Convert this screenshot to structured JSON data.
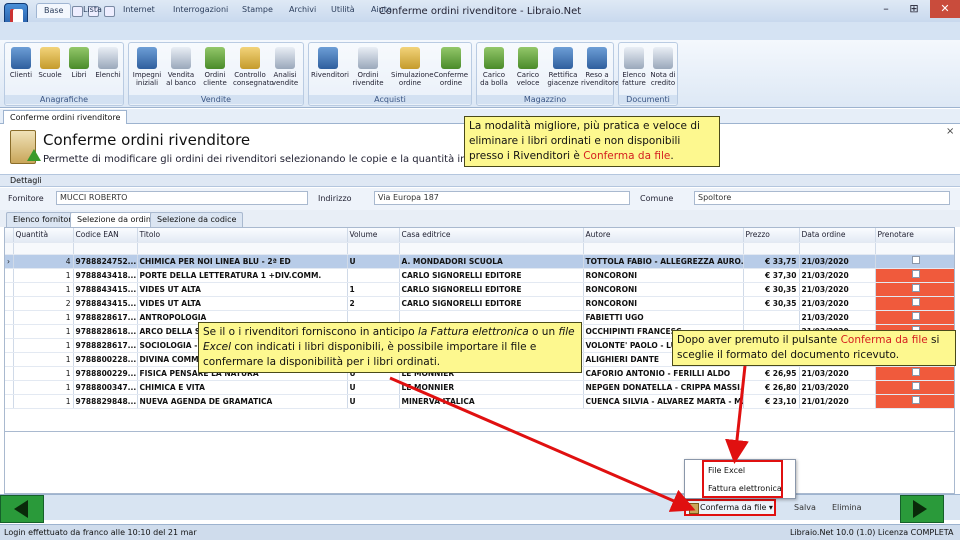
{
  "window": {
    "title": "Conferme ordini rivenditore - Libraio.Net",
    "minimize": "–",
    "restore": "⊞",
    "close": "✕"
  },
  "ribbon_tabs": [
    "Base",
    "Lista",
    "Internet",
    "Interrogazioni",
    "Stampe",
    "Archivi",
    "Utilità",
    "Aiuto"
  ],
  "ribbon_groups": [
    {
      "label": "Anagrafiche",
      "buttons": [
        "Clienti",
        "Scuole",
        "Libri",
        "Elenchi"
      ]
    },
    {
      "label": "Vendite",
      "buttons": [
        "Impegni iniziali",
        "Vendita al banco",
        "Ordini cliente",
        "Controllo consegnato",
        "Analisi vendite"
      ]
    },
    {
      "label": "Acquisti",
      "buttons": [
        "Rivenditori",
        "Ordini rivendite",
        "Simulazione ordine",
        "Conferme ordine"
      ]
    },
    {
      "label": "Magazzino",
      "buttons": [
        "Carico da bolla",
        "Carico veloce",
        "Rettifica giacenze",
        "Reso a rivenditore"
      ]
    },
    {
      "label": "Documenti",
      "buttons": [
        "Elenco fatture",
        "Nota di credito"
      ]
    }
  ],
  "doc_tab": "Conferme ordini rivenditore",
  "header": {
    "title": "Conferme ordini rivenditore",
    "subtitle": "Permette di modificare gli ordini dei rivenditori selezionando le copie e la quantità in arrivo",
    "close": "×"
  },
  "details": {
    "section": "Dettagli",
    "fornitore_label": "Fornitore",
    "fornitore": "MUCCI ROBERTO",
    "indirizzo_label": "Indirizzo",
    "indirizzo": "Via Europa 187",
    "comune_label": "Comune",
    "comune": "Spoltore"
  },
  "sub_tabs": [
    "Elenco fornitori",
    "Selezione da ordine",
    "Selezione da codice"
  ],
  "grid": {
    "columns": [
      "Quantità",
      "Codice EAN",
      "Titolo",
      "Volume",
      "Casa editrice",
      "Autore",
      "Prezzo",
      "Data ordine",
      "Prenotare"
    ],
    "rows": [
      {
        "q": "4",
        "ean": "9788824752...",
        "titolo": "CHIMICA PER NOI LINEA BLU - 2ª ED",
        "vol": "U",
        "casa": "A. MONDADORI SCUOLA",
        "autore": "TOTTOLA FABIO - ALLEGREZZA AURO...",
        "prezzo": "€ 33,75",
        "data": "21/03/2020"
      },
      {
        "q": "1",
        "ean": "9788843418...",
        "titolo": "PORTE DELLA LETTERATURA 1 +DIV.COMM.",
        "vol": "",
        "casa": "CARLO SIGNORELLI EDITORE",
        "autore": "RONCORONI",
        "prezzo": "€ 37,30",
        "data": "21/03/2020"
      },
      {
        "q": "1",
        "ean": "9788843415...",
        "titolo": "VIDES UT ALTA",
        "vol": "1",
        "casa": "CARLO SIGNORELLI EDITORE",
        "autore": "RONCORONI",
        "prezzo": "€ 30,35",
        "data": "21/03/2020"
      },
      {
        "q": "2",
        "ean": "9788843415...",
        "titolo": "VIDES UT ALTA",
        "vol": "2",
        "casa": "CARLO SIGNORELLI EDITORE",
        "autore": "RONCORONI",
        "prezzo": "€ 30,35",
        "data": "21/03/2020"
      },
      {
        "q": "1",
        "ean": "9788828617...",
        "titolo": "ANTROPOLOGIA",
        "vol": "",
        "casa": "",
        "autore": "FABIETTI UGO",
        "prezzo": "",
        "data": "21/03/2020"
      },
      {
        "q": "1",
        "ean": "9788828618...",
        "titolo": "ARCO DELLA ST",
        "vol": "",
        "casa": "",
        "autore": "OCCHIPINTI FRANCESC",
        "prezzo": "",
        "data": "21/03/2020"
      },
      {
        "q": "1",
        "ean": "9788828617...",
        "titolo": "SOCIOLOGIA - L",
        "vol": "",
        "casa": "",
        "autore": "VOLONTE' PAOLO - LUN",
        "prezzo": "",
        "data": "21/03/2020"
      },
      {
        "q": "1",
        "ean": "9788800228...",
        "titolo": "DIVINA COMMEDIA",
        "vol": "",
        "casa": "LE MONNIER",
        "autore": "ALIGHIERI DANTE",
        "prezzo": "€ 21,30",
        "data": "21/03/2020"
      },
      {
        "q": "1",
        "ean": "9788800229...",
        "titolo": "FISICA PENSARE LA NATURA",
        "vol": "U",
        "casa": "LE MONNIER",
        "autore": "CAFORIO ANTONIO - FERILLI ALDO",
        "prezzo": "€ 26,95",
        "data": "21/03/2020"
      },
      {
        "q": "1",
        "ean": "9788800347...",
        "titolo": "CHIMICA E VITA",
        "vol": "U",
        "casa": "LE MONNIER",
        "autore": "NEPGEN DONATELLA - CRIPPA MASSI...",
        "prezzo": "€ 26,80",
        "data": "21/03/2020"
      },
      {
        "q": "1",
        "ean": "9788829848...",
        "titolo": "NUEVA AGENDA DE GRAMATICA",
        "vol": "U",
        "casa": "MINERVA ITALICA",
        "autore": "CUENCA SILVIA - ALVAREZ MARTA - M...",
        "prezzo": "€ 23,10",
        "data": "21/01/2020"
      }
    ]
  },
  "menu": {
    "items": [
      "File Excel",
      "Fattura elettronica"
    ]
  },
  "bottom": {
    "conferma": "Conferma da file ▾",
    "salva": "Salva",
    "elimina": "Elimina"
  },
  "status": {
    "left": "Login effettuato da franco alle 10:10 del 21 mar",
    "right": "Libraio.Net 10.0 (1.0) Licenza COMPLETA"
  },
  "callouts": {
    "top": {
      "text": "La modalità migliore, più pratica e veloce di eliminare i libri ordinati e non disponibili presso i Rivenditori è ",
      "highlight": "Conferma da file",
      "end": "."
    },
    "left": {
      "a": "Se il o i rivenditori forniscono in anticipo ",
      "b": "la Fattura elettronica",
      "c": " o un ",
      "d": "file Excel",
      "e": " con indicati i libri disponibili, è possibile importare il file e confermare la disponibilità per i libri ordinati."
    },
    "right": {
      "a": "Dopo aver premuto il pulsante ",
      "b": "Conferma da file",
      "c": " si sceglie il formato del documento ricevuto."
    }
  },
  "colors": {
    "callout_bg": "#fdf88f",
    "highlight_red": "#e01010",
    "row_red": "#f05a3c",
    "nav_green": "#2a9a3a"
  }
}
